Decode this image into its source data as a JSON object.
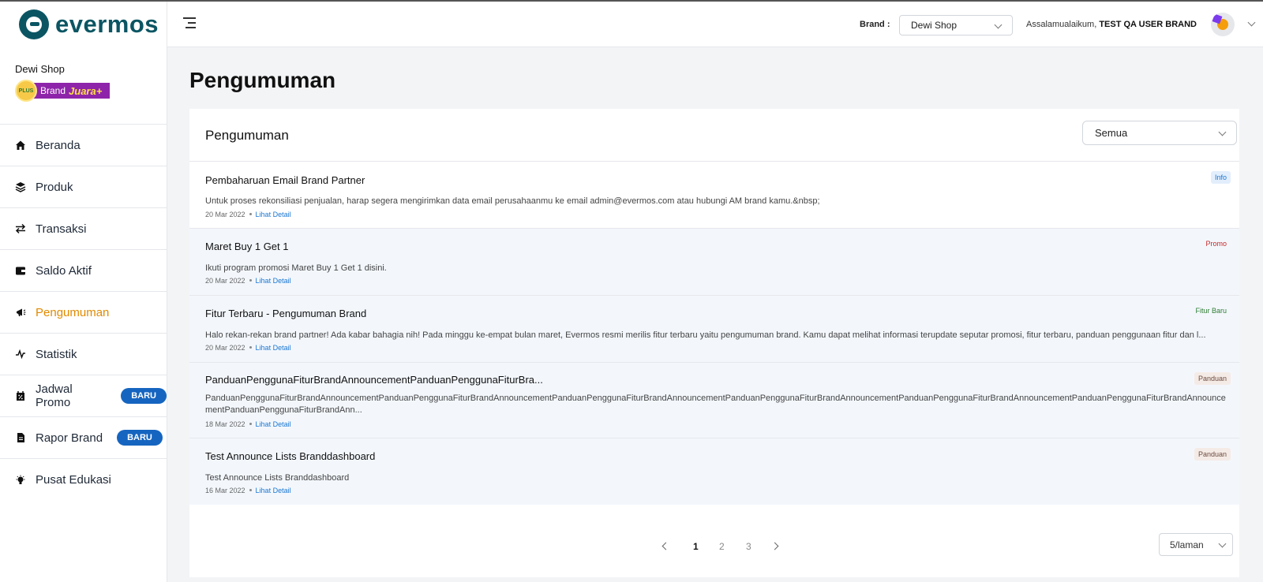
{
  "app": {
    "logo_text": "evermos"
  },
  "shop": {
    "name": "Dewi Shop",
    "badge_plus": "PLUS",
    "badge_brand": "Brand",
    "badge_tier": "Juara+"
  },
  "sidebar": {
    "items": [
      {
        "label": "Beranda",
        "icon": "home-icon"
      },
      {
        "label": "Produk",
        "icon": "layers-icon"
      },
      {
        "label": "Transaksi",
        "icon": "swap-icon"
      },
      {
        "label": "Saldo Aktif",
        "icon": "wallet-icon"
      },
      {
        "label": "Pengumuman",
        "icon": "megaphone-icon",
        "active": true
      },
      {
        "label": "Statistik",
        "icon": "activity-icon"
      },
      {
        "label": "Jadwal Promo",
        "icon": "calendar-percent-icon",
        "badge": "BARU"
      },
      {
        "label": "Rapor Brand",
        "icon": "report-icon",
        "badge": "BARU"
      },
      {
        "label": "Pusat Edukasi",
        "icon": "bulb-icon"
      }
    ]
  },
  "header": {
    "brand_label": "Brand :",
    "brand_value": "Dewi Shop",
    "greeting": "Assalamualaikum, ",
    "user": "TEST QA USER BRAND"
  },
  "page": {
    "title": "Pengumuman"
  },
  "card": {
    "title": "Pengumuman",
    "filter_value": "Semua",
    "announcements": [
      {
        "title": "Pembaharuan Email Brand Partner",
        "desc": "Untuk proses rekonsiliasi penjualan, harap segera mengirimkan data email perusahaanmu ke email admin@evermos.com atau hubungi AM brand kamu.&nbsp;",
        "date": "20 Mar 2022",
        "link": "Lihat Detail",
        "tag": "Info"
      },
      {
        "title": "Maret Buy 1 Get 1",
        "desc": "Ikuti program promosi Maret Buy 1 Get 1 disini.",
        "date": "20 Mar 2022",
        "link": "Lihat Detail",
        "tag": "Promo"
      },
      {
        "title": "Fitur Terbaru - Pengumuman Brand",
        "desc": "Halo rekan-rekan brand partner! Ada kabar bahagia nih! Pada minggu ke-empat bulan maret, Evermos resmi merilis fitur terbaru yaitu pengumuman brand. Kamu dapat melihat informasi terupdate seputar promosi, fitur terbaru, panduan penggunaan fitur dan l...",
        "date": "20 Mar 2022",
        "link": "Lihat Detail",
        "tag": "Fitur Baru"
      },
      {
        "title": "PanduanPenggunaFiturBrandAnnouncementPanduanPenggunaFiturBra...",
        "desc": "PanduanPenggunaFiturBrandAnnouncementPanduanPenggunaFiturBrandAnnouncementPanduanPenggunaFiturBrandAnnouncementPanduanPenggunaFiturBrandAnnouncementPanduanPenggunaFiturBrandAnnouncementPanduanPenggunaFiturBrandAnnouncementPanduanPenggunaFiturBrandAnn...",
        "date": "18 Mar 2022",
        "link": "Lihat Detail",
        "tag": "Panduan"
      },
      {
        "title": "Test Announce Lists Branddashboard",
        "desc": "Test Announce Lists Branddashboard",
        "date": "16 Mar 2022",
        "link": "Lihat Detail",
        "tag": "Panduan"
      }
    ],
    "pagination": {
      "pages": [
        "1",
        "2",
        "3"
      ],
      "current": "1",
      "per_page": "5/laman"
    }
  },
  "colors": {
    "brand": "#0b5563",
    "active_nav": "#e18a00",
    "badge_baru": "#1565c0",
    "link": "#1976d2"
  }
}
